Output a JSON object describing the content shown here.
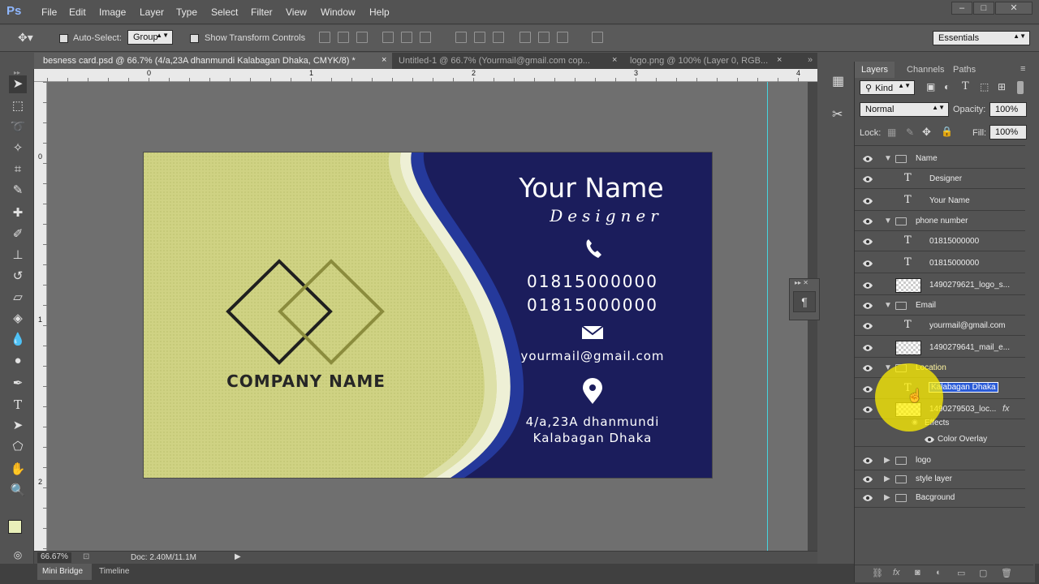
{
  "app": {
    "logo": "Ps"
  },
  "menu": [
    "File",
    "Edit",
    "Image",
    "Layer",
    "Type",
    "Select",
    "Filter",
    "View",
    "Window",
    "Help"
  ],
  "window_controls": [
    "–",
    "□",
    "✕"
  ],
  "options": {
    "auto_select_label": "Auto-Select:",
    "auto_select_value": "Group",
    "show_transform_label": "Show Transform Controls",
    "workspace": "Essentials"
  },
  "tabs": [
    "besness card.psd @ 66.7% (4/a,23A dhanmundi  Kalabagan Dhaka, CMYK/8) *",
    "Untitled-1 @ 66.7% (Yourmail@gmail.com cop...",
    "logo.png @ 100% (Layer 0, RGB..."
  ],
  "ruler_h": [
    "0",
    "1",
    "2",
    "3",
    "4"
  ],
  "ruler_v": [
    "0",
    "1",
    "2"
  ],
  "card": {
    "company": "COMPANY NAME",
    "name": "Your Name",
    "title": "Designer",
    "phone1": "01815000000",
    "phone2": "01815000000",
    "email": "yourmail@gmail.com",
    "address1": "4/a,23A dhanmundi",
    "address2": "Kalabagan Dhaka",
    "colors": {
      "left": "#cfd283",
      "right": "#1b1d5c",
      "accent": "#25399b",
      "logo_dark": "#1f1f1f",
      "logo_olive": "#8b8c3d"
    }
  },
  "status": {
    "zoom": "66.67%",
    "doc": "Doc: 2.40M/11.1M"
  },
  "bottom_tabs": [
    "Mini Bridge",
    "Timeline"
  ],
  "panel": {
    "tabs": [
      "Layers",
      "Channels",
      "Paths"
    ],
    "filter": "Kind",
    "blend": "Normal",
    "opacity_label": "Opacity:",
    "opacity": "100%",
    "lock_label": "Lock:",
    "fill_label": "Fill:",
    "fill": "100%",
    "layers": [
      {
        "type": "group",
        "name": "Name",
        "indent": 0,
        "open": true
      },
      {
        "type": "text",
        "name": "Designer",
        "indent": 1
      },
      {
        "type": "text",
        "name": "Your Name",
        "indent": 1
      },
      {
        "type": "group",
        "name": "phone number",
        "indent": 0,
        "open": true
      },
      {
        "type": "text",
        "name": "01815000000",
        "indent": 1
      },
      {
        "type": "text",
        "name": "01815000000",
        "indent": 1
      },
      {
        "type": "image",
        "name": "1490279621_logo_s...",
        "indent": 1
      },
      {
        "type": "group",
        "name": "Email",
        "indent": 0,
        "open": true
      },
      {
        "type": "text",
        "name": "yourmail@gmail.com",
        "indent": 1
      },
      {
        "type": "image",
        "name": "1490279641_mail_e...",
        "indent": 1
      },
      {
        "type": "group",
        "name": "Location",
        "indent": 0,
        "open": true
      },
      {
        "type": "text",
        "name": "Kalabagan Dhaka",
        "indent": 1,
        "editing": true
      },
      {
        "type": "image",
        "name": "1490279503_loc...",
        "indent": 1,
        "fx": true
      },
      {
        "type": "effects",
        "name": "Effects",
        "indent": 2
      },
      {
        "type": "effect",
        "name": "Color Overlay",
        "indent": 3
      },
      {
        "type": "group",
        "name": "logo",
        "indent": 0,
        "open": false
      },
      {
        "type": "group",
        "name": "style layer",
        "indent": 0,
        "open": false
      },
      {
        "type": "group",
        "name": "Bacground",
        "indent": 0,
        "open": false
      }
    ]
  }
}
